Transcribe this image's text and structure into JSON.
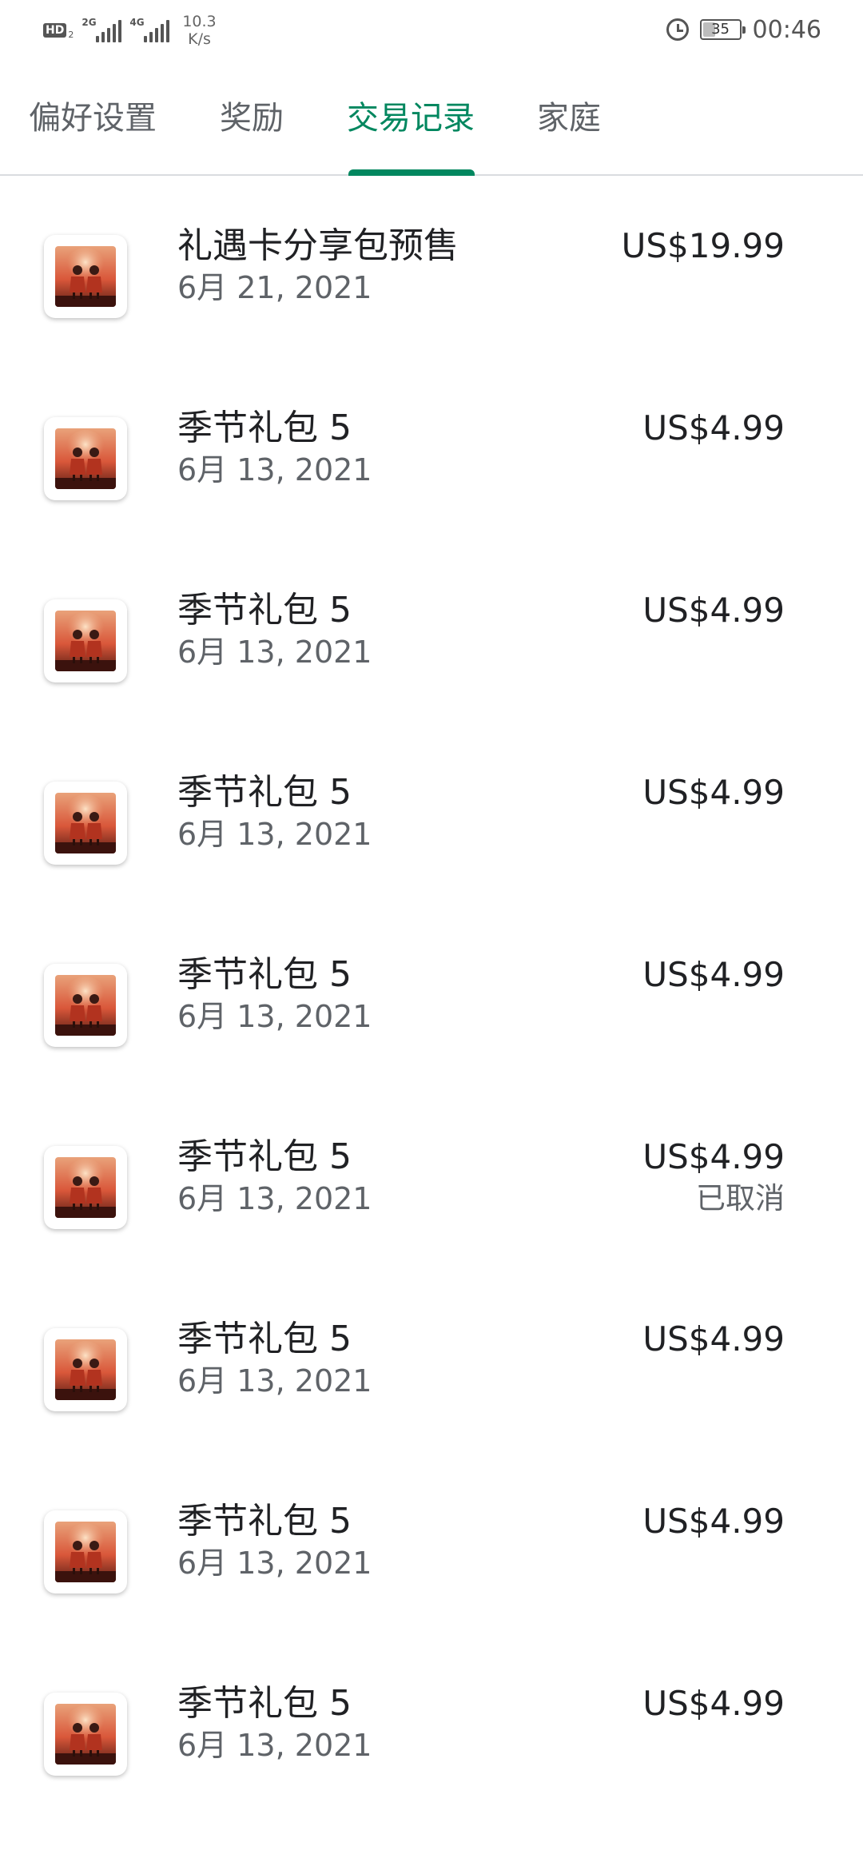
{
  "status_bar": {
    "hd_label": "HD",
    "hd_sub": "2",
    "sim1_network": "2G",
    "sim2_network": "4G",
    "speed_value": "10.3",
    "speed_unit": "K/s",
    "battery_level": "35",
    "time": "00:46"
  },
  "tabs": [
    {
      "label": "偏好设置",
      "active": false
    },
    {
      "label": "奖励",
      "active": false
    },
    {
      "label": "交易记录",
      "active": true
    },
    {
      "label": "家庭",
      "active": false
    }
  ],
  "accent_color": "#01875f",
  "transactions": [
    {
      "title": "礼遇卡分享包预售",
      "date": "6月 21, 2021",
      "price": "US$19.99",
      "status": ""
    },
    {
      "title": "季节礼包 5",
      "date": "6月 13, 2021",
      "price": "US$4.99",
      "status": ""
    },
    {
      "title": "季节礼包 5",
      "date": "6月 13, 2021",
      "price": "US$4.99",
      "status": ""
    },
    {
      "title": "季节礼包 5",
      "date": "6月 13, 2021",
      "price": "US$4.99",
      "status": ""
    },
    {
      "title": "季节礼包 5",
      "date": "6月 13, 2021",
      "price": "US$4.99",
      "status": ""
    },
    {
      "title": "季节礼包 5",
      "date": "6月 13, 2021",
      "price": "US$4.99",
      "status": "已取消"
    },
    {
      "title": "季节礼包 5",
      "date": "6月 13, 2021",
      "price": "US$4.99",
      "status": ""
    },
    {
      "title": "季节礼包 5",
      "date": "6月 13, 2021",
      "price": "US$4.99",
      "status": ""
    },
    {
      "title": "季节礼包 5",
      "date": "6月 13, 2021",
      "price": "US$4.99",
      "status": ""
    }
  ],
  "icons": {
    "app_icon": "game-app-icon",
    "alarm": "alarm-icon",
    "battery": "battery-icon",
    "signal": "signal-icon"
  }
}
